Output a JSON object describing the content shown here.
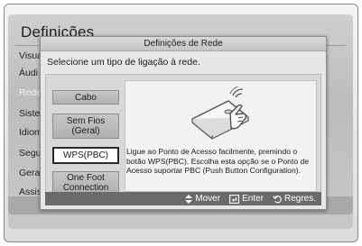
{
  "screen": {
    "title": "Definições",
    "menu_items": [
      "Visua",
      "Áudi",
      "Rede",
      "Siste",
      "Idiom",
      "Segu",
      "Geral",
      "Assis"
    ]
  },
  "dialog": {
    "title": "Definições de Rede",
    "prompt": "Selecione um tipo de ligação à rede.",
    "options": [
      {
        "label": "Cabo"
      },
      {
        "label": "Sem Fios (Geral)"
      },
      {
        "label": "WPS(PBC)"
      },
      {
        "label": "One Foot Connection"
      }
    ],
    "selected_option": "WPS(PBC)",
    "description": "Ligue ao Ponto de Acesso facilmente, premindo o botão WPS(PBC). Escolha esta opção se o Ponto de Acesso suportar PBC (Push Button Configuration).",
    "illustration_icon": "router-press-icon",
    "footer": {
      "move_label": "Mover",
      "enter_label": "Enter",
      "return_label": "Regres.",
      "move_icon": "up-down-arrows-icon",
      "enter_icon": "enter-icon",
      "return_icon": "return-icon"
    }
  }
}
